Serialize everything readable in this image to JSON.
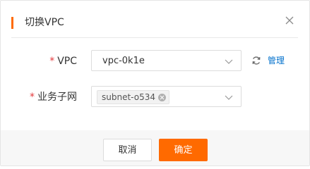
{
  "dialog": {
    "title": "切换VPC",
    "accent_color": "#ff6a00",
    "close_icon": "close-icon"
  },
  "form": {
    "vpc": {
      "required_mark": "*",
      "label": "VPC",
      "value": "vpc-0k1e",
      "refresh_icon": "refresh-icon",
      "manage_link": "管理"
    },
    "subnet": {
      "required_mark": "*",
      "label": "业务子网",
      "selected_tags": [
        "subnet-o534"
      ]
    }
  },
  "footer": {
    "cancel_label": "取消",
    "ok_label": "确定"
  },
  "colors": {
    "primary": "#ff6a00",
    "link": "#0070cc",
    "required": "#e4393c"
  }
}
